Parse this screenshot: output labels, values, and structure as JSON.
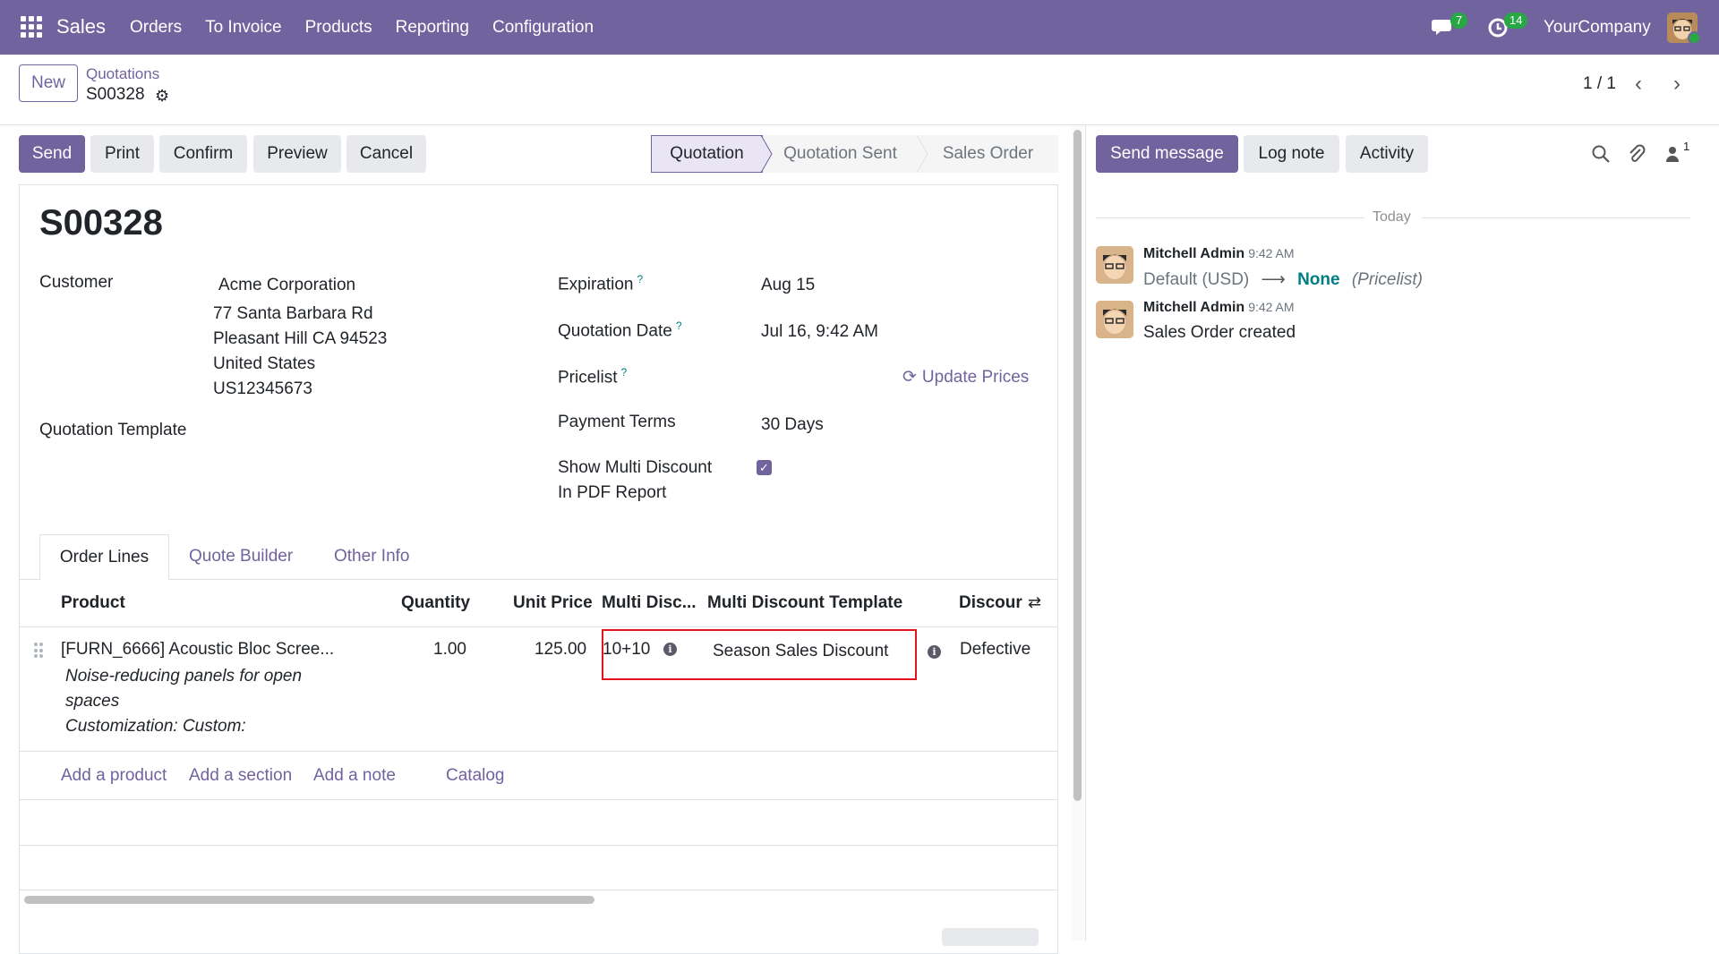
{
  "navbar": {
    "app_name": "Sales",
    "menu": [
      "Orders",
      "To Invoice",
      "Products",
      "Reporting",
      "Configuration"
    ],
    "messages_count": "7",
    "activities_count": "14",
    "company": "YourCompany",
    "bg_color": "#71639e"
  },
  "control_panel": {
    "new_label": "New",
    "breadcrumb_parent": "Quotations",
    "breadcrumb_current": "S00328",
    "pager": "1 / 1"
  },
  "statusbar": {
    "buttons": [
      "Send",
      "Print",
      "Confirm",
      "Preview",
      "Cancel"
    ],
    "stages": [
      "Quotation",
      "Quotation Sent",
      "Sales Order"
    ],
    "active_stage": "Quotation"
  },
  "form": {
    "title": "S00328",
    "customer_label": "Customer",
    "customer_name": "Acme Corporation",
    "address": [
      "77 Santa Barbara Rd",
      "Pleasant Hill CA 94523",
      "United States",
      "US12345673"
    ],
    "quotation_template_label": "Quotation Template",
    "expiration_label": "Expiration",
    "expiration_value": "Aug 15",
    "quotation_date_label": "Quotation Date",
    "quotation_date_value": "Jul 16, 9:42 AM",
    "pricelist_label": "Pricelist",
    "update_prices": "Update Prices",
    "payment_terms_label": "Payment Terms",
    "payment_terms_value": "30 Days",
    "multi_discount_label_1": "Show Multi Discount",
    "multi_discount_label_2": "In PDF Report",
    "multi_discount_checked": true,
    "help_mark": "?"
  },
  "tabs": [
    "Order Lines",
    "Quote Builder",
    "Other Info"
  ],
  "table": {
    "headers": [
      "Product",
      "Quantity",
      "Unit Price",
      "Multi Disc...",
      "Multi Discount Template",
      "Discour"
    ],
    "row": {
      "product": "[FURN_6666] Acoustic Bloc Scree...",
      "description_1": "Noise-reducing panels for open",
      "description_2": "spaces",
      "description_3": "Customization: Custom:",
      "quantity": "1.00",
      "unit_price": "125.00",
      "multi_discount": "10+10",
      "multi_discount_template": "Season Sales Discount",
      "discount_reason": "Defective"
    },
    "add_links": [
      "Add a product",
      "Add a section",
      "Add a note",
      "Catalog"
    ]
  },
  "chatter": {
    "buttons": [
      "Send message",
      "Log note",
      "Activity"
    ],
    "followers_count": "1",
    "date_separator": "Today",
    "messages": [
      {
        "author": "Mitchell Admin",
        "time": "9:42 AM",
        "old_value": "Default (USD)",
        "new_value": "None",
        "field": "(Pricelist)"
      },
      {
        "author": "Mitchell Admin",
        "time": "9:42 AM",
        "body": "Sales Order created"
      }
    ]
  }
}
